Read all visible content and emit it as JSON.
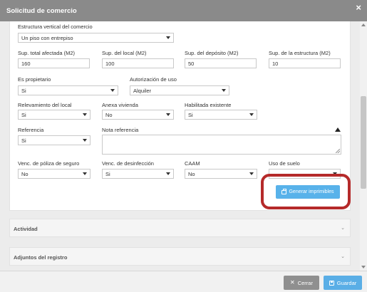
{
  "modal": {
    "title": "Solicitud de comercio",
    "close_symbol": "×"
  },
  "form": {
    "estructura_vertical": {
      "label": "Estructura vertical del comercio",
      "value": "Un piso con entrepiso"
    },
    "sup_total": {
      "label": "Sup. total afectada (M2)",
      "value": "160"
    },
    "sup_local": {
      "label": "Sup. del local (M2)",
      "value": "100"
    },
    "sup_deposito": {
      "label": "Sup. del depósito (M2)",
      "value": "50"
    },
    "sup_estructura": {
      "label": "Sup. de la estructura (M2)",
      "value": "10"
    },
    "es_propietario": {
      "label": "Es propietario",
      "value": "Si"
    },
    "autorizacion_uso": {
      "label": "Autorización de uso",
      "value": "Alquiler"
    },
    "relevamiento_local": {
      "label": "Relevamiento del local",
      "value": "Si"
    },
    "anexa_vivienda": {
      "label": "Anexa vivienda",
      "value": "No"
    },
    "habilitada_existente": {
      "label": "Habilitada existente",
      "value": "Si"
    },
    "referencia": {
      "label": "Referencia",
      "value": "Si"
    },
    "nota_referencia": {
      "label": "Nota referencia",
      "value": ""
    },
    "venc_poliza": {
      "label": "Venc. de póliza de seguro",
      "value": "No"
    },
    "venc_desinfeccion": {
      "label": "Venc. de desinfección",
      "value": "Si"
    },
    "caam": {
      "label": "CAAM",
      "value": "No"
    },
    "uso_suelo": {
      "label": "Uso de suelo",
      "value": ""
    }
  },
  "buttons": {
    "generar": "Generar imprimibles",
    "cerrar": "Cerrar",
    "guardar": "Guardar"
  },
  "sections": [
    {
      "title": "Actividad"
    },
    {
      "title": "Adjuntos del registro"
    }
  ],
  "icons": {
    "printer": "printer-icon",
    "close": "close-icon",
    "save": "save-icon",
    "chevron": "chevron-down-icon",
    "collapse": "caret-up-icon"
  },
  "colors": {
    "header": "#8a8a8a",
    "primary_button": "#58b2ea",
    "close_button": "#8f8f8f",
    "highlight": "#b52a2a"
  }
}
